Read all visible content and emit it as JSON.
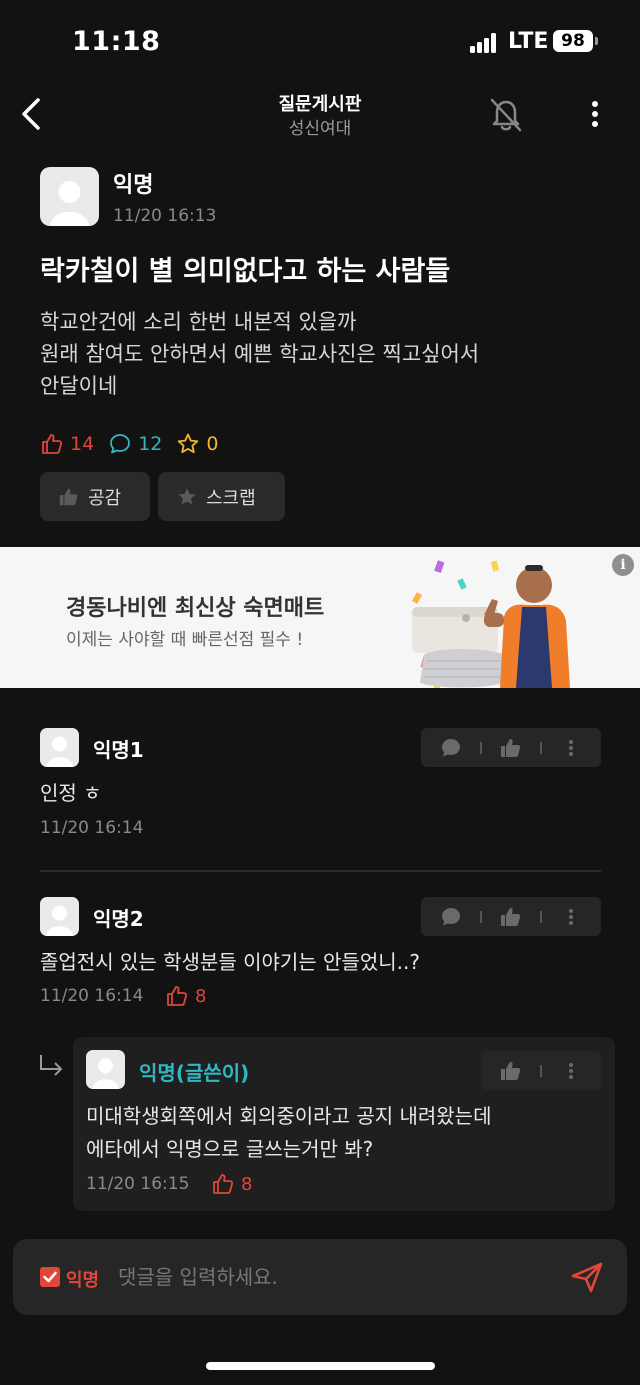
{
  "status_bar": {
    "time": "11:18",
    "network": "LTE",
    "battery": "98"
  },
  "nav": {
    "title": "질문게시판",
    "subtitle": "성신여대"
  },
  "post": {
    "author": "익명",
    "time": "11/20 16:13",
    "title": "락카칠이 별 의미없다고 하는 사람들",
    "body_lines": [
      "학교안건에 소리 한번 내본적 있을까",
      "원래 참여도 안하면서 예쁜 학교사진은 찍고싶어서",
      "안달이네"
    ],
    "likes": "14",
    "comments": "12",
    "scraps": "0",
    "like_button": "공감",
    "scrap_button": "스크랩"
  },
  "ad": {
    "title": "경동나비엔 최신상 숙면매트",
    "subtitle": "이제는 사야할 때 빠른선점 필수 !",
    "info": "i"
  },
  "comments": [
    {
      "author": "익명1",
      "text": "인정 ㅎ",
      "time": "11/20 16:14",
      "likes": ""
    },
    {
      "author": "익명2",
      "text": "졸업전시 있는 학생분들 이야기는 안들었니..?",
      "time": "11/20 16:14",
      "likes": "8"
    }
  ],
  "reply": {
    "author": "익명(글쓴이)",
    "text_lines": [
      "미대학생회쪽에서 회의중이라고 공지 내려왔는데",
      "에타에서 익명으로 글쓰는거만 봐?"
    ],
    "time": "11/20 16:15",
    "likes": "8"
  },
  "comment_bar": {
    "anonymous_label": "익명",
    "anonymous_checked": true,
    "placeholder": "댓글을 입력하세요."
  },
  "colors": {
    "background": "#121212",
    "accent_red": "#e0463a",
    "accent_teal": "#2fb8c4",
    "accent_yellow": "#f1b72d"
  }
}
